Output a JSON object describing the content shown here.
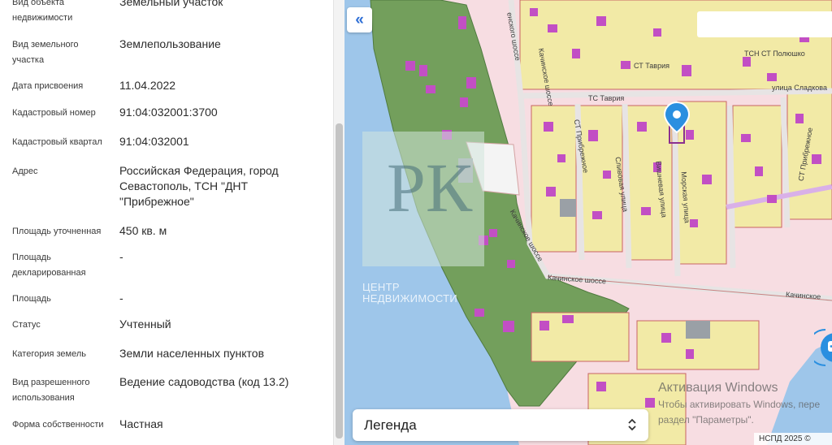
{
  "info": {
    "rows": [
      {
        "label": "Вид объекта недвижимости",
        "value": "Земельный участок"
      },
      {
        "label": "Вид земельного участка",
        "value": "Землепользование"
      },
      {
        "label": "Дата присвоения",
        "value": "11.04.2022"
      },
      {
        "label": "Кадастровый номер",
        "value": "91:04:032001:3700"
      },
      {
        "label": "Кадастровый квартал",
        "value": "91:04:032001"
      },
      {
        "label": "Адрес",
        "value": "Российская Федерация, город Севастополь, ТСН \"ДНТ \"Прибрежное\""
      },
      {
        "label": "Площадь уточненная",
        "value": "450 кв. м"
      },
      {
        "label": "Площадь декларированная",
        "value": "-"
      },
      {
        "label": "Площадь",
        "value": "-"
      },
      {
        "label": "Статус",
        "value": "Учтенный"
      },
      {
        "label": "Категория земель",
        "value": "Земли населенных пунктов"
      },
      {
        "label": "Вид разрешенного использования",
        "value": "Ведение садоводства (код 13.2)"
      },
      {
        "label": "Форма собственности",
        "value": "Частная"
      }
    ]
  },
  "map": {
    "collapse_icon": "double-chevron-left-icon",
    "legend_label": "Легенда",
    "legend_icon": "chevron-up-down-icon",
    "watermark": {
      "letters": "РК",
      "text": "ЦЕНТР\nНЕДВИЖИМОСТИ"
    },
    "streets": [
      {
        "name": "ТС Таврия"
      },
      {
        "name": "СТ Таврия"
      },
      {
        "name": "ТСН СТ Полюшко"
      },
      {
        "name": "улица Сладкова"
      },
      {
        "name": "Качинское шоссе"
      },
      {
        "name": "Качинское шоссе"
      },
      {
        "name": "Качинское шоссе"
      },
      {
        "name": "Качинское"
      },
      {
        "name": "СТ Прибрежное"
      },
      {
        "name": "Сливовая улица"
      },
      {
        "name": "Вишневая улица"
      },
      {
        "name": "Морская улица"
      },
      {
        "name": "СТ Прибрежное"
      },
      {
        "name": "енского шоссе"
      }
    ],
    "windows_activation": {
      "title": "Активация Windows",
      "text": "Чтобы активировать Windows, пере\nраздел \"Параметры\"."
    },
    "copyright": "НСПД 2025 ©",
    "colors": {
      "water": "#9ec6ea",
      "green_zone": "#6f9e59",
      "parcel_fill": "#f2eaa6",
      "parcel_border": "#c86464",
      "building": "#c24fc4",
      "road": "#e9e9e9",
      "marker": "#2a8fe0",
      "accent": "#2f6fd6"
    }
  }
}
